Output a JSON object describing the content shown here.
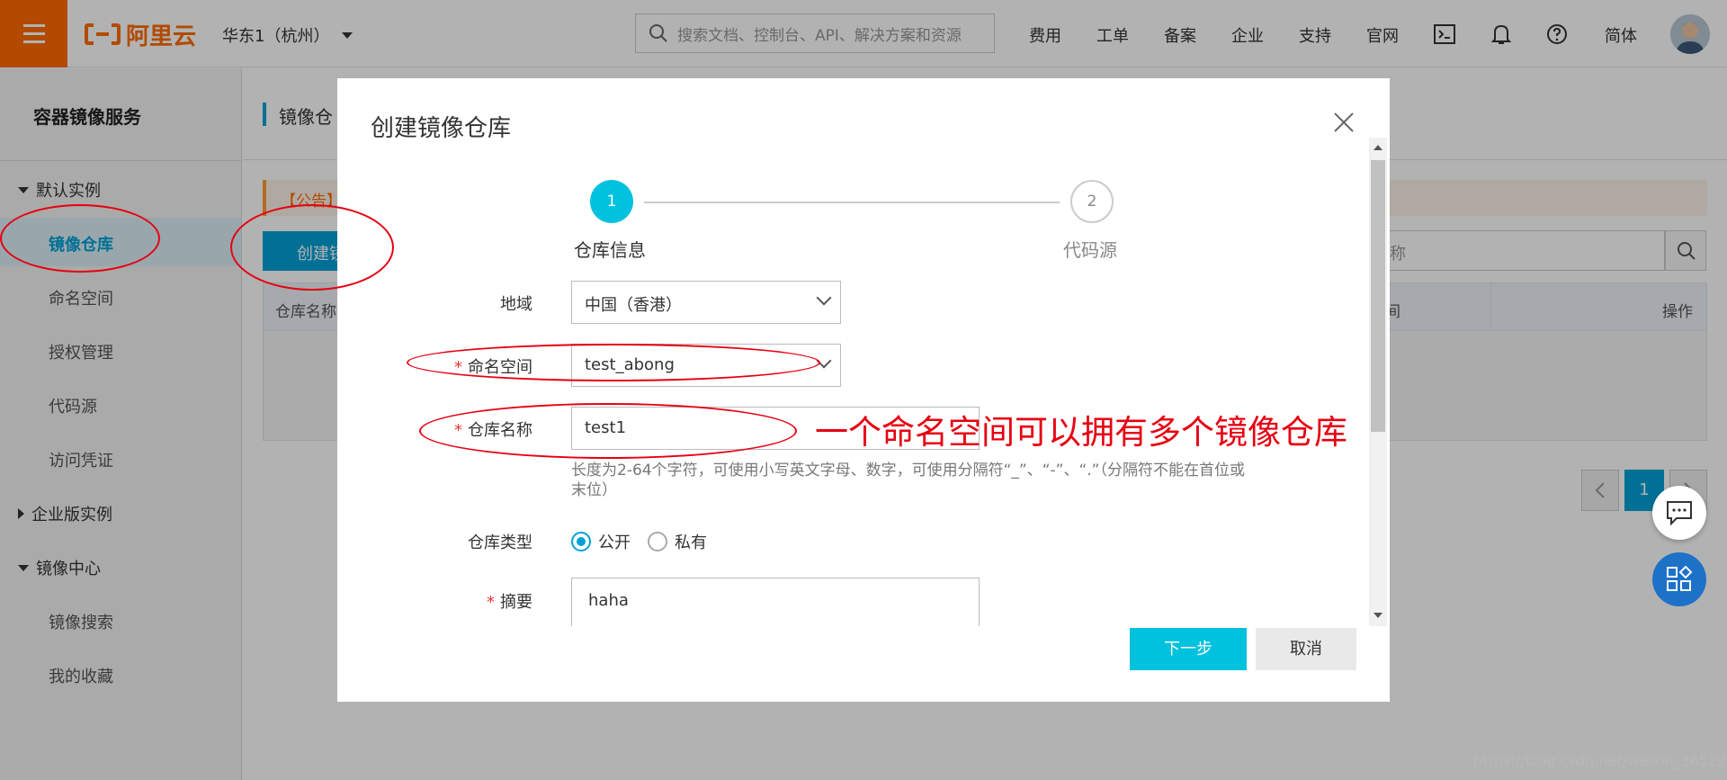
{
  "topbar": {
    "brand": "阿里云",
    "region": "华东1（杭州）",
    "search_placeholder": "搜索文档、控制台、API、解决方案和资源",
    "nav": [
      "费用",
      "工单",
      "备案",
      "企业",
      "支持",
      "官网"
    ],
    "lang": "简体"
  },
  "sidebar": {
    "title": "容器镜像服务",
    "group_default": "默认实例",
    "items_default": [
      "镜像仓库",
      "命名空间",
      "授权管理",
      "代码源",
      "访问凭证"
    ],
    "group_enterprise": "企业版实例",
    "group_center": "镜像中心",
    "items_center": [
      "镜像搜索",
      "我的收藏"
    ]
  },
  "main": {
    "breadcrumb": "镜像仓",
    "notice": "【公告】",
    "create_button": "创建镜",
    "filter_placeholder": "称",
    "table_col_first": "仓库名称",
    "table_col_partial": "间",
    "table_col_op": "操作",
    "page_current": "1"
  },
  "modal": {
    "title": "创建镜像仓库",
    "steps": [
      {
        "num": "1",
        "label": "仓库信息"
      },
      {
        "num": "2",
        "label": "代码源"
      }
    ],
    "region_label": "地域",
    "region_value": "中国（香港）",
    "namespace_label": "命名空间",
    "namespace_value": "test_abong",
    "repo_name_label": "仓库名称",
    "repo_name_value": "test1",
    "repo_name_hint": "长度为2-64个字符，可使用小写英文字母、数字，可使用分隔符“_”、“-”、“.”（分隔符不能在首位或末位）",
    "repo_type_label": "仓库类型",
    "repo_type_public": "公开",
    "repo_type_private": "私有",
    "summary_label": "摘要",
    "summary_value": "haha",
    "next_button": "下一步",
    "cancel_button": "取消"
  },
  "annotation": "一个命名空间可以拥有多个镜像仓库",
  "watermark": "https://blog.csdn.net/weixin_36522099",
  "colors": {
    "brand_orange": "#ff6a00",
    "accent_blue": "#00a1d6",
    "step_active": "#00c1de",
    "annotation_red": "#e60012"
  }
}
